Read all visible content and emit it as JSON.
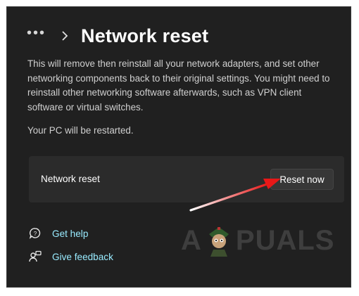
{
  "breadcrumb": {
    "more_label": "•••",
    "title": "Network reset"
  },
  "description": "This will remove then reinstall all your network adapters, and set other networking components back to their original settings. You might need to reinstall other networking software afterwards, such as VPN client software or virtual switches.",
  "restart_note": "Your PC will be restarted.",
  "reset_card": {
    "label": "Network reset",
    "button_label": "Reset now"
  },
  "links": {
    "help_label": "Get help",
    "feedback_label": "Give feedback"
  },
  "watermark": {
    "left": "A",
    "right": "PUALS"
  },
  "colors": {
    "background": "#202020",
    "card": "#2b2b2b",
    "link": "#99ebff",
    "annotation_arrow": "#e81818"
  },
  "icons": {
    "breadcrumb_more": "ellipsis-icon",
    "breadcrumb_separator": "chevron-right-icon",
    "help": "help-chat-icon",
    "feedback": "feedback-person-icon"
  }
}
